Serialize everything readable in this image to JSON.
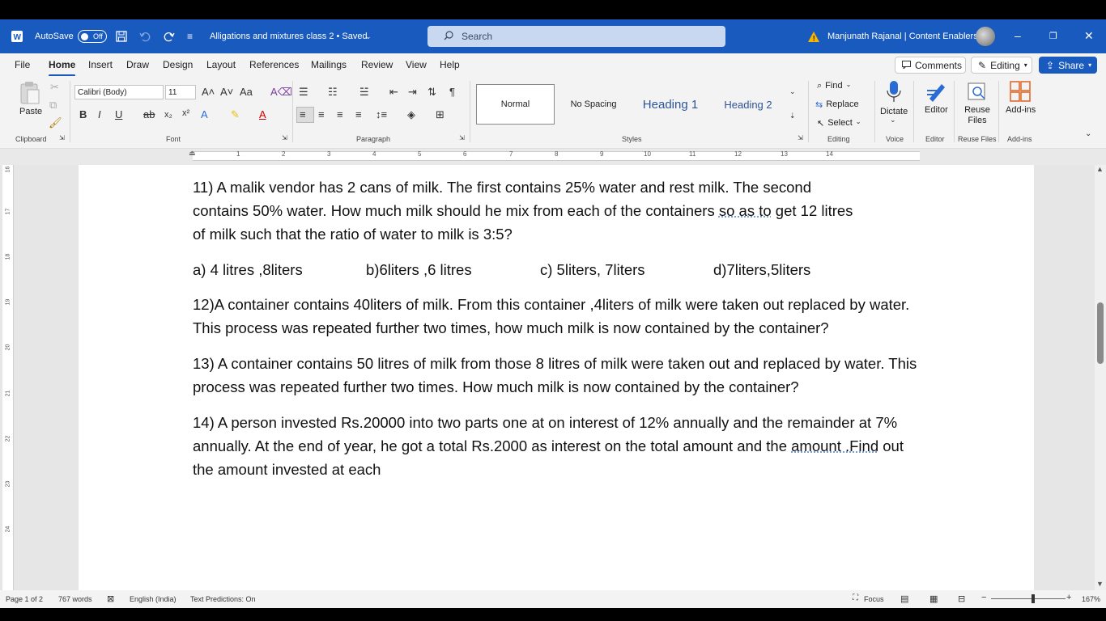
{
  "titlebar": {
    "autosave_label": "AutoSave",
    "autosave_state": "Off",
    "doc_title": "Alligations and mixtures class 2 • Saved",
    "search_placeholder": "Search",
    "user_name": "Manjunath Rajanal | Content Enablers"
  },
  "menu": {
    "items": [
      "File",
      "Home",
      "Insert",
      "Draw",
      "Design",
      "Layout",
      "References",
      "Mailings",
      "Review",
      "View",
      "Help"
    ],
    "active": "Home",
    "comments_label": "Comments",
    "editing_label": "Editing",
    "share_label": "Share"
  },
  "ribbon": {
    "paste_label": "Paste",
    "font_name": "Calibri (Body)",
    "font_size": "11",
    "styles": [
      "Normal",
      "No Spacing",
      "Heading 1",
      "Heading 2"
    ],
    "find_label": "Find",
    "replace_label": "Replace",
    "select_label": "Select",
    "dictate_label": "Dictate",
    "editor_label": "Editor",
    "reuse_files_label": "Reuse Files",
    "addins_label": "Add-ins",
    "groups": {
      "clipboard": "Clipboard",
      "font": "Font",
      "paragraph": "Paragraph",
      "styles": "Styles",
      "editing": "Editing",
      "voice": "Voice",
      "editor": "Editor",
      "reuse_files": "Reuse Files",
      "addins": "Add-ins"
    }
  },
  "ruler": {
    "numbers": [
      "1",
      "2",
      "3",
      "4",
      "5",
      "6",
      "7",
      "8",
      "9",
      "10",
      "11",
      "12",
      "13",
      "14"
    ],
    "vertical_numbers": [
      "16",
      "17",
      "18",
      "19",
      "20",
      "21",
      "22",
      "23",
      "24"
    ]
  },
  "document": {
    "q11_line1": "11) A malik vendor has 2 cans of milk. The first contains 25% water and rest milk. The second",
    "q11_line2a": "contains 50% water. How much milk should he mix from each of the containers ",
    "q11_line2b": "so as to",
    "q11_line2c": " get 12 litres",
    "q11_line3": "of milk such that the ratio of water to milk is 3:5?",
    "options": [
      "a) 4 litres ,8liters",
      "b)6liters ,6 litres",
      "c) 5liters, 7liters",
      "d)7liters,5liters"
    ],
    "q12": "12)A container contains 40liters of milk. From this container ,4liters of milk were taken out replaced by water. This process was repeated further two times, how much milk is now contained by the container?",
    "q13": "13) A container contains 50 litres of milk from those 8 litres of milk were taken out and replaced by water. This process was repeated further two times. How much milk is now contained by the container?",
    "q14a": "14) A person invested Rs.20000 into two parts one at on interest of 12% annually and the remainder at 7% annually. At the end of year, he got a total Rs.2000 as interest on the total amount and the ",
    "q14b": "amount .Find",
    "q14c": " out the amount invested at each"
  },
  "status": {
    "page": "Page 1 of 2",
    "words": "767 words",
    "language": "English (India)",
    "predictions": "Text Predictions: On",
    "focus": "Focus",
    "zoom": "167%"
  }
}
